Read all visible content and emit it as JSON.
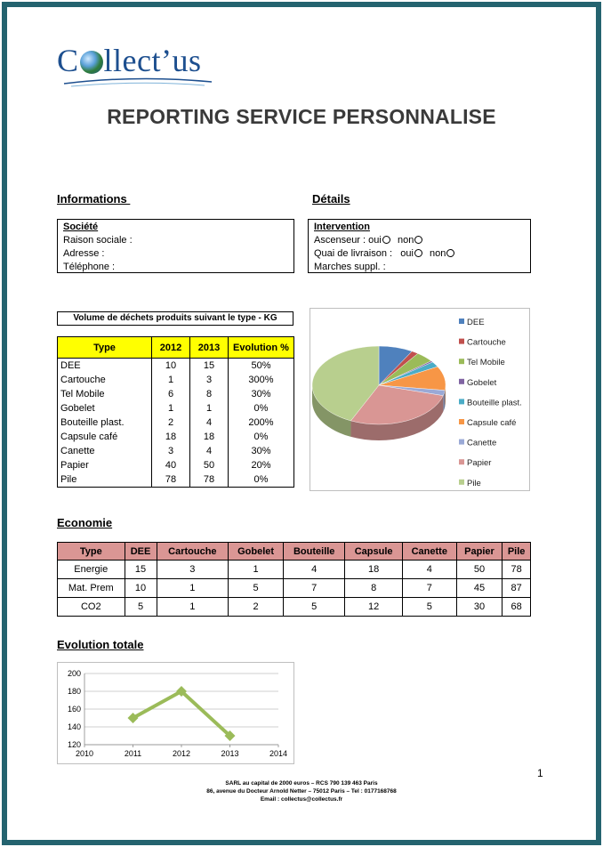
{
  "logo": {
    "text": "Collect'us"
  },
  "title": "REPORTING SERVICE PERSONNALISE",
  "informations": {
    "heading": "Informations ",
    "box_title": "Société",
    "lines": [
      "Raison sociale :",
      "Adresse :",
      "Téléphone :"
    ]
  },
  "details": {
    "heading": "Détails",
    "box_title": "Intervention",
    "ascenseur_label": "Ascenseur :",
    "quai_label": "Quai de livraison :",
    "oui": "oui",
    "non": "non",
    "marches_label": "Marches suppl. :"
  },
  "volume_table": {
    "caption": "Volume de déchets produits suivant le type - KG",
    "headers": [
      "Type",
      "2012",
      "2013",
      "Evolution %"
    ],
    "rows": [
      [
        "DEE",
        "10",
        "15",
        "50%"
      ],
      [
        "Cartouche",
        "1",
        "3",
        "300%"
      ],
      [
        "Tel Mobile",
        "6",
        "8",
        "30%"
      ],
      [
        "Gobelet",
        "1",
        "1",
        "0%"
      ],
      [
        "Bouteille plast.",
        "2",
        "4",
        "200%"
      ],
      [
        "Capsule café",
        "18",
        "18",
        "0%"
      ],
      [
        "Canette",
        "3",
        "4",
        "30%"
      ],
      [
        "Papier",
        "40",
        "50",
        "20%"
      ],
      [
        "Pile",
        "78",
        "78",
        "0%"
      ]
    ]
  },
  "economie": {
    "heading": "Economie",
    "headers": [
      "Type",
      "DEE",
      "Cartouche",
      "Gobelet",
      "Bouteille",
      "Capsule",
      "Canette",
      "Papier",
      "Pile"
    ],
    "rows": [
      [
        "Energie",
        "15",
        "3",
        "1",
        "4",
        "18",
        "4",
        "50",
        "78"
      ],
      [
        "Mat. Prem",
        "10",
        "1",
        "5",
        "7",
        "8",
        "7",
        "45",
        "87"
      ],
      [
        "CO2",
        "5",
        "1",
        "2",
        "5",
        "12",
        "5",
        "30",
        "68"
      ]
    ]
  },
  "evolution_heading": "Evolution totale",
  "page_number": "1",
  "footer": {
    "line1": "SARL au capital de 2000 euros – RCS 790 139 463 Paris",
    "line2": "86, avenue du Docteur Arnold Netter – 75012 Paris – Tel : 0177168768",
    "line3": "Email : collectus@collectus.fr"
  },
  "chart_data": [
    {
      "type": "pie",
      "title": "",
      "categories": [
        "DEE",
        "Cartouche",
        "Tel Mobile",
        "Gobelet",
        "Bouteille plast.",
        "Capsule café",
        "Canette",
        "Papier",
        "Pile"
      ],
      "values": [
        15,
        3,
        8,
        1,
        4,
        18,
        4,
        50,
        78
      ],
      "colors": [
        "#4f81bd",
        "#c0504d",
        "#9bbb59",
        "#8064a2",
        "#4bacc6",
        "#f79646",
        "#9aa9d6",
        "#d99694",
        "#b8cf8e"
      ],
      "legend": "right"
    },
    {
      "type": "line",
      "title": "",
      "xlabel": "",
      "ylabel": "",
      "x": [
        2011,
        2012,
        2013
      ],
      "y": [
        150,
        180,
        130
      ],
      "xlim": [
        2010,
        2014
      ],
      "ylim": [
        120,
        200
      ],
      "xticks": [
        2010,
        2011,
        2012,
        2013,
        2014
      ],
      "yticks": [
        120,
        140,
        160,
        180,
        200
      ],
      "grid": true,
      "color": "#9bbb59"
    }
  ]
}
